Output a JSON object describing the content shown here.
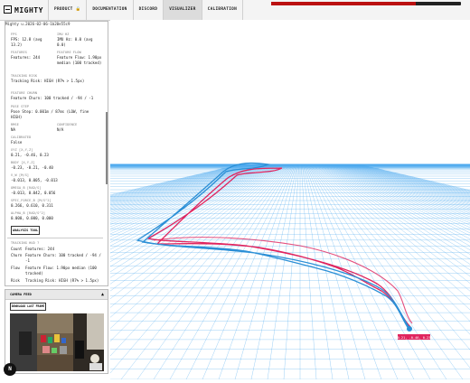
{
  "header": {
    "logo": "MIGHTY",
    "nav": [
      {
        "label": "PRODUCT 🔒"
      },
      {
        "label": "DOCUMENTATION"
      },
      {
        "label": "DISCORD"
      },
      {
        "label": "VISUALIZER",
        "active": true
      },
      {
        "label": "CALIBRATION"
      }
    ],
    "load_progress": 0.76
  },
  "sidebar": {
    "session": "Mighty u.2026-02-06-1b20e55c9",
    "fps_label": "FPS",
    "fps_value": "FPS: 12.8 (avg 13.2)",
    "imu_label": "IMU HZ",
    "imu_value": "IMU Hz: 0.0 (avg 0.0)",
    "features_label": "FEATURES",
    "features_value": "Features: 244",
    "flow_label": "FEATURE FLOW",
    "flow_value": "Feature Flow: 1.90px median (100 tracked)",
    "risk_label": "TRACKING RISK",
    "risk_value": "Tracking Risk: HIGH (R7% > 1.5px)",
    "churn_label": "FEATURE CHURN",
    "churn_value": "Feature Churn: 100 tracked / -94 / -1",
    "pose_label": "POSE STEP",
    "pose_value": "Pose Step: 0.001m / 87ms (LOW, fine HIGH)",
    "rmse_label": "RMSE",
    "rmse_value": "NA",
    "conf_label": "CONFIDENCE",
    "conf_value": "N/A",
    "calib_label": "CALIBRATED",
    "calib_value": "False",
    "xyz_label": "XYZ [X,Y,Z]",
    "xyz_value": "0.21, -0.46, 0.23",
    "body_label": "BODY [X,Y,Z]",
    "body_value": "-0.23, -0.21, -0.40",
    "vw_label": "V_W [M/S]",
    "vw_value": "-0.013, 0.005, -0.013",
    "omega_label": "OMEGA_B [RAD/S]",
    "omega_value": "-0.013, 0.042, 0.056",
    "force_label": "SPEC_FORCE_B [M/S^2]",
    "force_value": "0.266, 0.610, 0.311",
    "alpha_label": "ALPHA_B [RAD/S^2]",
    "alpha_value": "0.000, 0.000, 0.000",
    "analysis_button": "ANALYSIS TOOL",
    "hud_label": "TRACKING HUD ?",
    "hud_count_key": "Count",
    "hud_count_val": "Features: 244",
    "hud_churn_key": "Churn",
    "hud_churn_val": "Feature Churn: 100 tracked / -94 / -1",
    "hud_flow_key": "Flow",
    "hud_flow_val": "Feature Flow: 1.90px median (100 tracked)",
    "hud_risk_key": "Risk",
    "hud_risk_val": "Tracking Risk: HIGH (R7% > 1.5px)"
  },
  "camera": {
    "title": "CAMERA FEED",
    "collapse": "▲",
    "download": "DOWNLOAD LAST FRAME"
  },
  "fab": "N",
  "viz": {
    "marker_label": "0.21, -0.46, 0.23",
    "gt_color": "#e0245e",
    "est_color": "#2b8fd6",
    "sky_color": "#ffffff",
    "grid_color": "#4aa8ee"
  }
}
